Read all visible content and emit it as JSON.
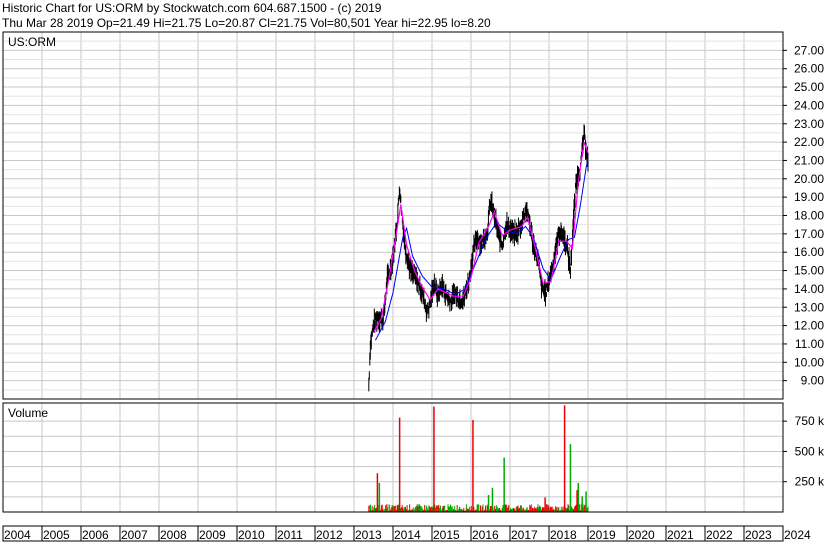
{
  "header": {
    "line1": "Historic Chart for US:ORM by Stockwatch.com 604.687.1500 - (c) 2019",
    "line2": "Thu Mar 28 2019   Op=21.49  Hi=21.75  Lo=20.87  Cl=21.75  Vol=80,501   Year hi=22.95   lo=8.20"
  },
  "colors": {
    "grid": "#c8c8c8",
    "frame": "#000000",
    "price": "#000000",
    "ma_short": "#ff00ff",
    "ma_long": "#0000ff",
    "vol_up": "#00aa00",
    "vol_down": "#ee0000"
  },
  "chart_data": [
    {
      "type": "line",
      "symbol": "US:ORM",
      "x_range": [
        2004,
        2024
      ],
      "ylim": [
        8,
        28
      ],
      "y_ticks": [
        "9.00",
        "10.00",
        "11.00",
        "12.00",
        "13.00",
        "14.00",
        "15.00",
        "16.00",
        "17.00",
        "18.00",
        "19.00",
        "20.00",
        "21.00",
        "22.00",
        "23.00",
        "24.00",
        "25.00",
        "26.00",
        "27.00"
      ],
      "x_ticks": [
        "2004",
        "2005",
        "2006",
        "2007",
        "2008",
        "2009",
        "2010",
        "2011",
        "2012",
        "2013",
        "2014",
        "2015",
        "2016",
        "2017",
        "2018",
        "2019",
        "2020",
        "2021",
        "2022",
        "2023",
        "2024"
      ],
      "price": [
        [
          2013.38,
          8.8
        ],
        [
          2013.42,
          11.0
        ],
        [
          2013.5,
          12.0
        ],
        [
          2013.6,
          12.5
        ],
        [
          2013.75,
          12.3
        ],
        [
          2013.85,
          14.5
        ],
        [
          2013.95,
          15.2
        ],
        [
          2014.05,
          16.5
        ],
        [
          2014.12,
          18.0
        ],
        [
          2014.17,
          19.6
        ],
        [
          2014.22,
          18.2
        ],
        [
          2014.32,
          16.2
        ],
        [
          2014.45,
          15.0
        ],
        [
          2014.6,
          14.5
        ],
        [
          2014.75,
          13.8
        ],
        [
          2014.87,
          12.8
        ],
        [
          2014.95,
          13.2
        ],
        [
          2015.05,
          14.3
        ],
        [
          2015.15,
          13.6
        ],
        [
          2015.25,
          14.2
        ],
        [
          2015.35,
          13.7
        ],
        [
          2015.5,
          13.3
        ],
        [
          2015.6,
          13.8
        ],
        [
          2015.7,
          13.4
        ],
        [
          2015.82,
          13.5
        ],
        [
          2015.95,
          14.5
        ],
        [
          2016.05,
          16.0
        ],
        [
          2016.15,
          16.8
        ],
        [
          2016.3,
          16.5
        ],
        [
          2016.42,
          17.2
        ],
        [
          2016.5,
          18.8
        ],
        [
          2016.6,
          18.0
        ],
        [
          2016.7,
          17.0
        ],
        [
          2016.8,
          16.4
        ],
        [
          2016.9,
          17.5
        ],
        [
          2017.0,
          17.2
        ],
        [
          2017.15,
          16.9
        ],
        [
          2017.3,
          17.6
        ],
        [
          2017.4,
          18.4
        ],
        [
          2017.5,
          17.6
        ],
        [
          2017.6,
          16.4
        ],
        [
          2017.72,
          15.5
        ],
        [
          2017.82,
          14.0
        ],
        [
          2017.92,
          13.8
        ],
        [
          2018.02,
          14.6
        ],
        [
          2018.12,
          15.5
        ],
        [
          2018.2,
          16.5
        ],
        [
          2018.28,
          17.2
        ],
        [
          2018.38,
          16.8
        ],
        [
          2018.47,
          16.2
        ],
        [
          2018.55,
          15.0
        ],
        [
          2018.62,
          17.5
        ],
        [
          2018.7,
          20.0
        ],
        [
          2018.8,
          20.5
        ],
        [
          2018.9,
          22.4
        ],
        [
          2018.96,
          21.5
        ],
        [
          2019.0,
          21.0
        ]
      ],
      "ma_short": [
        [
          2013.5,
          11.6
        ],
        [
          2013.7,
          12.4
        ],
        [
          2013.9,
          14.6
        ],
        [
          2014.1,
          17.2
        ],
        [
          2014.2,
          18.6
        ],
        [
          2014.35,
          16.4
        ],
        [
          2014.55,
          15.0
        ],
        [
          2014.75,
          14.1
        ],
        [
          2014.95,
          13.4
        ],
        [
          2015.15,
          14.0
        ],
        [
          2015.35,
          13.8
        ],
        [
          2015.55,
          13.6
        ],
        [
          2015.8,
          13.6
        ],
        [
          2016.0,
          14.6
        ],
        [
          2016.2,
          16.5
        ],
        [
          2016.45,
          17.4
        ],
        [
          2016.6,
          18.2
        ],
        [
          2016.8,
          16.9
        ],
        [
          2017.0,
          17.2
        ],
        [
          2017.3,
          17.4
        ],
        [
          2017.45,
          17.9
        ],
        [
          2017.65,
          16.2
        ],
        [
          2017.85,
          14.3
        ],
        [
          2018.05,
          14.4
        ],
        [
          2018.25,
          16.6
        ],
        [
          2018.45,
          16.6
        ],
        [
          2018.6,
          16.2
        ],
        [
          2018.75,
          19.8
        ],
        [
          2018.9,
          22.0
        ],
        [
          2019.0,
          21.4
        ]
      ],
      "ma_long": [
        [
          2013.55,
          11.2
        ],
        [
          2013.8,
          12.2
        ],
        [
          2014.0,
          13.8
        ],
        [
          2014.25,
          16.8
        ],
        [
          2014.35,
          17.3
        ],
        [
          2014.5,
          15.8
        ],
        [
          2014.75,
          14.7
        ],
        [
          2015.0,
          14.1
        ],
        [
          2015.3,
          14.0
        ],
        [
          2015.6,
          13.7
        ],
        [
          2015.85,
          14.0
        ],
        [
          2016.1,
          15.3
        ],
        [
          2016.4,
          16.8
        ],
        [
          2016.65,
          17.6
        ],
        [
          2016.9,
          17.2
        ],
        [
          2017.15,
          17.0
        ],
        [
          2017.4,
          17.4
        ],
        [
          2017.6,
          16.8
        ],
        [
          2017.85,
          15.1
        ],
        [
          2018.05,
          14.5
        ],
        [
          2018.3,
          15.8
        ],
        [
          2018.5,
          16.7
        ],
        [
          2018.65,
          16.8
        ],
        [
          2018.8,
          18.5
        ],
        [
          2018.95,
          20.6
        ],
        [
          2019.0,
          21.1
        ]
      ]
    },
    {
      "type": "bar",
      "title": "Volume",
      "ylim": [
        0,
        900
      ],
      "y_ticks": [
        "250 k",
        "500 k",
        "750 k"
      ],
      "spikes_up": [
        [
          2013.65,
          240
        ],
        [
          2016.45,
          140
        ],
        [
          2016.55,
          200
        ],
        [
          2016.85,
          450
        ],
        [
          2018.55,
          560
        ],
        [
          2018.85,
          130
        ],
        [
          2018.95,
          170
        ],
        [
          2018.75,
          240
        ]
      ],
      "spikes_down": [
        [
          2013.6,
          320
        ],
        [
          2014.17,
          780
        ],
        [
          2015.05,
          870
        ],
        [
          2016.05,
          760
        ],
        [
          2017.9,
          120
        ],
        [
          2018.4,
          880
        ],
        [
          2018.72,
          180
        ]
      ],
      "start": 2013.38,
      "end": 2019.0
    }
  ]
}
